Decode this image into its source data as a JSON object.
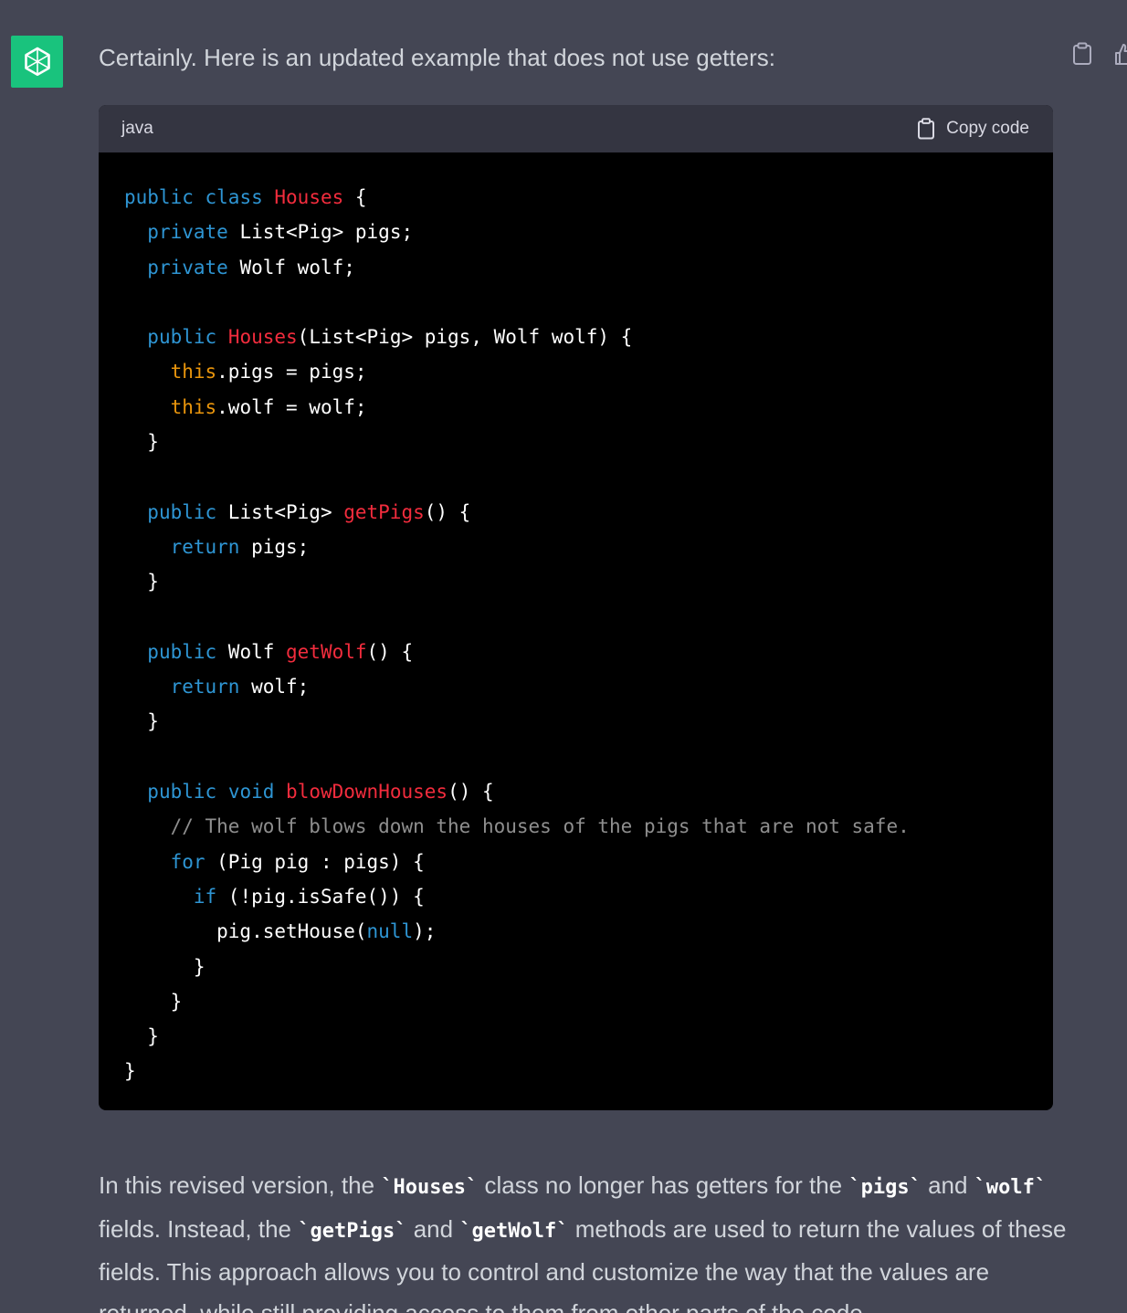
{
  "message": {
    "intro": "Certainly. Here is an updated example that does not use getters:",
    "avatar_icon": "openai-logo-icon",
    "avatar_color": "#19c37d"
  },
  "actions": {
    "copy_icon": "clipboard-icon",
    "thumb_icon": "thumbs-up-icon"
  },
  "code_block": {
    "language": "java",
    "copy_label": "Copy code",
    "lines": [
      [
        [
          "kw",
          "public"
        ],
        [
          "plain",
          " "
        ],
        [
          "kw",
          "class"
        ],
        [
          "plain",
          " "
        ],
        [
          "title",
          "Houses"
        ],
        [
          "plain",
          " {"
        ]
      ],
      [
        [
          "plain",
          "  "
        ],
        [
          "kw",
          "private"
        ],
        [
          "plain",
          " List<Pig> pigs;"
        ]
      ],
      [
        [
          "plain",
          "  "
        ],
        [
          "kw",
          "private"
        ],
        [
          "plain",
          " Wolf wolf;"
        ]
      ],
      [
        [
          "plain",
          ""
        ]
      ],
      [
        [
          "plain",
          "  "
        ],
        [
          "kw",
          "public"
        ],
        [
          "plain",
          " "
        ],
        [
          "title",
          "Houses"
        ],
        [
          "plain",
          "(List<Pig> pigs, Wolf wolf) {"
        ]
      ],
      [
        [
          "plain",
          "    "
        ],
        [
          "this",
          "this"
        ],
        [
          "plain",
          ".pigs = pigs;"
        ]
      ],
      [
        [
          "plain",
          "    "
        ],
        [
          "this",
          "this"
        ],
        [
          "plain",
          ".wolf = wolf;"
        ]
      ],
      [
        [
          "plain",
          "  }"
        ]
      ],
      [
        [
          "plain",
          ""
        ]
      ],
      [
        [
          "plain",
          "  "
        ],
        [
          "kw",
          "public"
        ],
        [
          "plain",
          " List<Pig> "
        ],
        [
          "title",
          "getPigs"
        ],
        [
          "plain",
          "() {"
        ]
      ],
      [
        [
          "plain",
          "    "
        ],
        [
          "kw",
          "return"
        ],
        [
          "plain",
          " pigs;"
        ]
      ],
      [
        [
          "plain",
          "  }"
        ]
      ],
      [
        [
          "plain",
          ""
        ]
      ],
      [
        [
          "plain",
          "  "
        ],
        [
          "kw",
          "public"
        ],
        [
          "plain",
          " Wolf "
        ],
        [
          "title",
          "getWolf"
        ],
        [
          "plain",
          "() {"
        ]
      ],
      [
        [
          "plain",
          "    "
        ],
        [
          "kw",
          "return"
        ],
        [
          "plain",
          " wolf;"
        ]
      ],
      [
        [
          "plain",
          "  }"
        ]
      ],
      [
        [
          "plain",
          ""
        ]
      ],
      [
        [
          "plain",
          "  "
        ],
        [
          "kw",
          "public"
        ],
        [
          "plain",
          " "
        ],
        [
          "kw",
          "void"
        ],
        [
          "plain",
          " "
        ],
        [
          "title",
          "blowDownHouses"
        ],
        [
          "plain",
          "() {"
        ]
      ],
      [
        [
          "plain",
          "    "
        ],
        [
          "comment",
          "// The wolf blows down the houses of the pigs that are not safe."
        ]
      ],
      [
        [
          "plain",
          "    "
        ],
        [
          "kw",
          "for"
        ],
        [
          "plain",
          " (Pig pig : pigs) {"
        ]
      ],
      [
        [
          "plain",
          "      "
        ],
        [
          "kw",
          "if"
        ],
        [
          "plain",
          " (!pig.isSafe()) {"
        ]
      ],
      [
        [
          "plain",
          "        pig.setHouse("
        ],
        [
          "kw",
          "null"
        ],
        [
          "plain",
          ");"
        ]
      ],
      [
        [
          "plain",
          "      }"
        ]
      ],
      [
        [
          "plain",
          "    }"
        ]
      ],
      [
        [
          "plain",
          "  }"
        ]
      ],
      [
        [
          "plain",
          "}"
        ]
      ]
    ]
  },
  "explanation": {
    "p1": "In this revised version, the ",
    "c1": "`Houses`",
    "p2": " class no longer has getters for the ",
    "c2": "`pigs`",
    "p3": " and ",
    "c3": "`wolf`",
    "p4": " fields. Instead, the ",
    "c4": "`getPigs`",
    "p5": " and ",
    "c5": "`getWolf`",
    "p6": " methods are used to return the values of these fields. This approach allows you to control and customize the way that the values are returned, while still providing access to them from other parts of the code."
  }
}
